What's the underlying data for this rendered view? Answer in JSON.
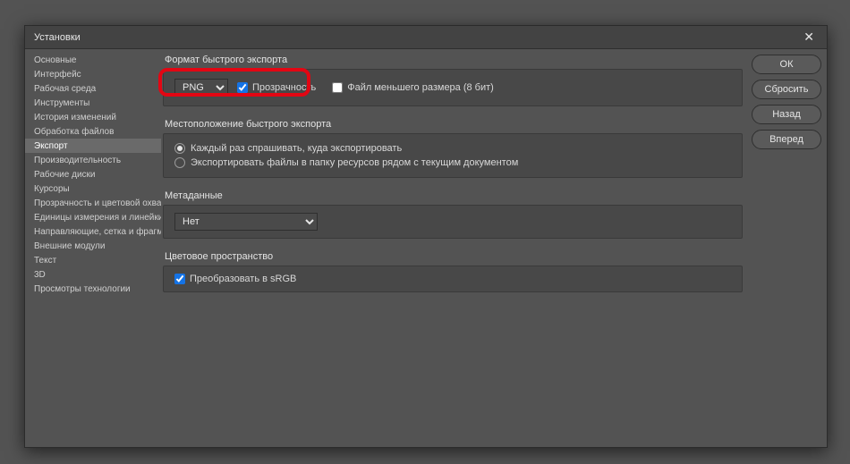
{
  "dialog": {
    "title": "Установки"
  },
  "sidebar": {
    "items": [
      {
        "label": "Основные"
      },
      {
        "label": "Интерфейс"
      },
      {
        "label": "Рабочая среда"
      },
      {
        "label": "Инструменты"
      },
      {
        "label": "История изменений"
      },
      {
        "label": "Обработка файлов"
      },
      {
        "label": "Экспорт"
      },
      {
        "label": "Производительность"
      },
      {
        "label": "Рабочие диски"
      },
      {
        "label": "Курсоры"
      },
      {
        "label": "Прозрачность и цветовой охват"
      },
      {
        "label": "Единицы измерения и линейки"
      },
      {
        "label": "Направляющие, сетка и фрагменты"
      },
      {
        "label": "Внешние модули"
      },
      {
        "label": "Текст"
      },
      {
        "label": "3D"
      },
      {
        "label": "Просмотры технологии"
      }
    ],
    "selected_index": 6
  },
  "sections": {
    "quick_export": {
      "title": "Формат быстрого экспорта",
      "format_value": "PNG",
      "transparency_label": "Прозрачность",
      "transparency_checked": true,
      "small_file_label": "Файл меньшего размера (8 бит)",
      "small_file_checked": false
    },
    "location": {
      "title": "Местоположение быстрого экспорта",
      "opt_ask_label": "Каждый раз спрашивать, куда экспортировать",
      "opt_folder_label": "Экспортировать файлы в папку ресурсов рядом с текущим документом",
      "selected": 0
    },
    "metadata": {
      "title": "Метаданные",
      "value": "Нет"
    },
    "colorspace": {
      "title": "Цветовое пространство",
      "convert_label": "Преобразовать в sRGB",
      "convert_checked": true
    }
  },
  "buttons": {
    "ok": "ОК",
    "reset": "Сбросить",
    "back": "Назад",
    "forward": "Вперед"
  }
}
